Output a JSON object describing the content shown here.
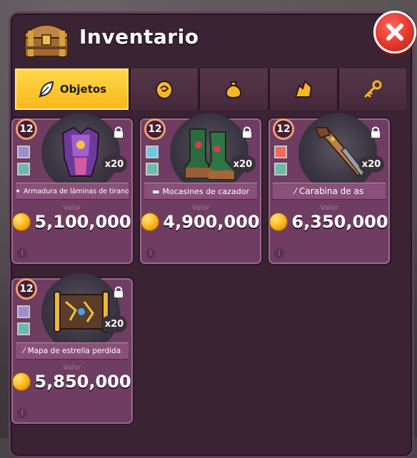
{
  "header": {
    "title": "Inventario",
    "chest_icon": "treasure-chest-icon",
    "close_icon": "close-x-icon"
  },
  "tabs": [
    {
      "label": "Objetos",
      "icon": "feather-quill-icon",
      "active": true
    },
    {
      "label": "",
      "icon": "egg-icon",
      "active": false
    },
    {
      "label": "",
      "icon": "money-bag-icon",
      "active": false
    },
    {
      "label": "",
      "icon": "gem-crystal-icon",
      "active": false
    },
    {
      "label": "",
      "icon": "key-icon",
      "active": false
    }
  ],
  "items": [
    {
      "level": "12",
      "qty": "x20",
      "name": "Armadura de láminas de tirano",
      "value_label": "Valor",
      "price": "5,100,000",
      "slot1_color": "#9d8bd3",
      "slot2_color": "#6fb8b0"
    },
    {
      "level": "12",
      "qty": "x20",
      "name": "Mocasines de cazador",
      "value_label": "Valor",
      "price": "4,900,000",
      "slot1_color": "#6cc6e8",
      "slot2_color": "#6fb8b0"
    },
    {
      "level": "12",
      "qty": "x20",
      "name": "Carabina de as",
      "value_label": "Valor",
      "price": "6,350,000",
      "slot1_color": "#ef6a5c",
      "slot2_color": "#6fb8b0"
    },
    {
      "level": "12",
      "qty": "x20",
      "name": "Mapa de estrella perdida",
      "value_label": "Valor",
      "price": "5,850,000",
      "slot1_color": "#9d8bd3",
      "slot2_color": "#6fb8b0"
    }
  ],
  "colors": {
    "tab_active": "#f7b81a",
    "card_bg": "#6e3d61",
    "coin": "#f9b316",
    "close_button": "#e4352a"
  }
}
